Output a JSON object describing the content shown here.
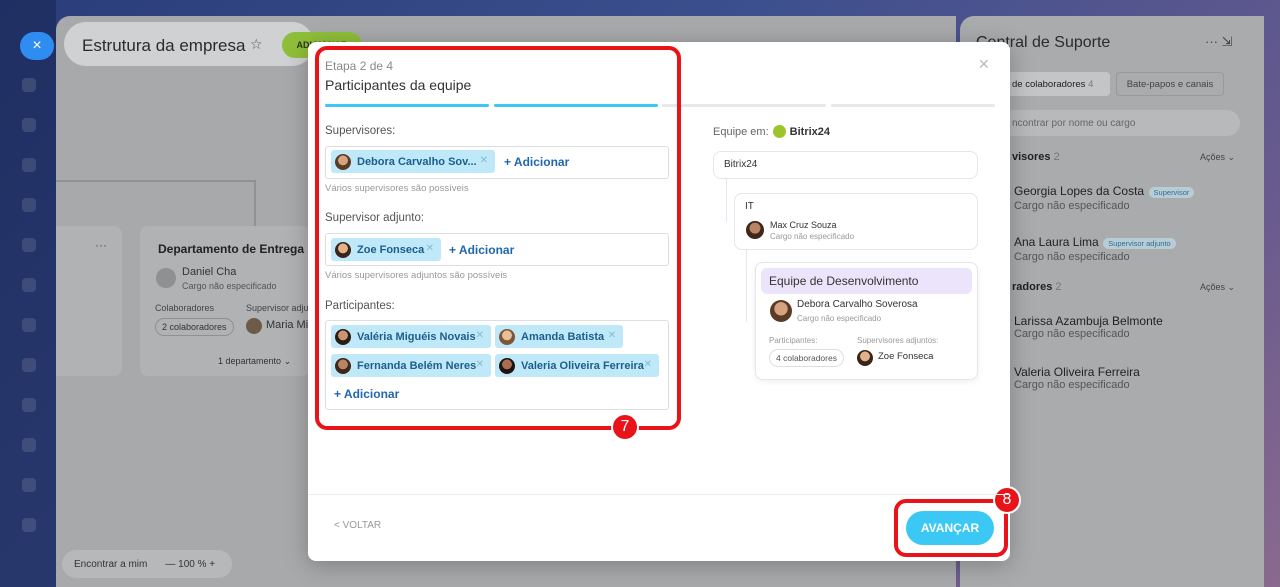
{
  "background": {
    "close_icon": "×",
    "app_title": "Estrutura da empresa",
    "pin_icon": "pin-icon",
    "add_button": "ADICIONAR",
    "dept_card": {
      "title": "Departamento de Entrega",
      "head_name": "Daniel Cha",
      "head_role": "Cargo não especificado",
      "collab_label": "Colaboradores",
      "deputy_label": "Supervisor adjunto",
      "collab_count": "2 colaboradores",
      "deputy_name": "Maria Mi",
      "departments": "1 departamento"
    },
    "find_me": "Encontrar a mim",
    "zoom": "100"
  },
  "right_panel": {
    "title": "Central de Suporte",
    "tab_colab": "de colaboradores",
    "tab_colab_count": "4",
    "tab_chats": "Bate-papos e canais",
    "search_placeholder": "ncontrar por nome ou cargo",
    "supervisors_section": "visores",
    "supervisors_count": "2",
    "actions": "Ações",
    "supervisors": [
      {
        "name": "Georgia Lopes da Costa",
        "badge": "Supervisor",
        "role": "Cargo não especificado"
      },
      {
        "name": "Ana Laura Lima",
        "badge": "Supervisor adjunto",
        "role": "Cargo não especificado"
      }
    ],
    "collab_section": "radores",
    "collab_count": "2",
    "collaborators": [
      {
        "name": "Larissa Azambuja Belmonte",
        "role": "Cargo não especificado"
      },
      {
        "name": "Valeria Oliveira Ferreira",
        "role": "Cargo não especificado"
      }
    ]
  },
  "modal": {
    "step": "Etapa 2 de 4",
    "title": "Participantes da equipe",
    "progress": {
      "current": 2,
      "total": 4
    },
    "supervisors_label": "Supervisores:",
    "supervisor_chip": "Debora Carvalho Sov...",
    "add_label": "+ Adicionar",
    "supervisors_hint": "Vários supervisores são possíveis",
    "deputy_label": "Supervisor adjunto:",
    "deputy_chip": "Zoe Fonseca",
    "deputy_hint": "Vários supervisores adjuntos são possíveis",
    "participants_label": "Participantes:",
    "participants": [
      "Valéria Miguéis Novais",
      "Amanda Batista",
      "Fernanda Belém Neres",
      "Valeria Oliveira Ferreira"
    ],
    "back": "< VOLTAR",
    "next": "AVANÇAR",
    "callouts": [
      "7",
      "8"
    ],
    "preview": {
      "team_in": "Equipe em:",
      "company": "Bitrix24",
      "root": "Bitrix24",
      "it": "IT",
      "it_head": "Max Cruz Souza",
      "it_head_role": "Cargo não especificado",
      "team_name": "Equipe de Desenvolvimento",
      "team_head": "Debora Carvalho Soverosa",
      "team_head_role": "Cargo não especificado",
      "participants_label": "Participantes:",
      "deputies_label": "Supervisores adjuntos:",
      "collab_count": "4 colaboradores",
      "deputy_name": "Zoe Fonseca"
    }
  }
}
